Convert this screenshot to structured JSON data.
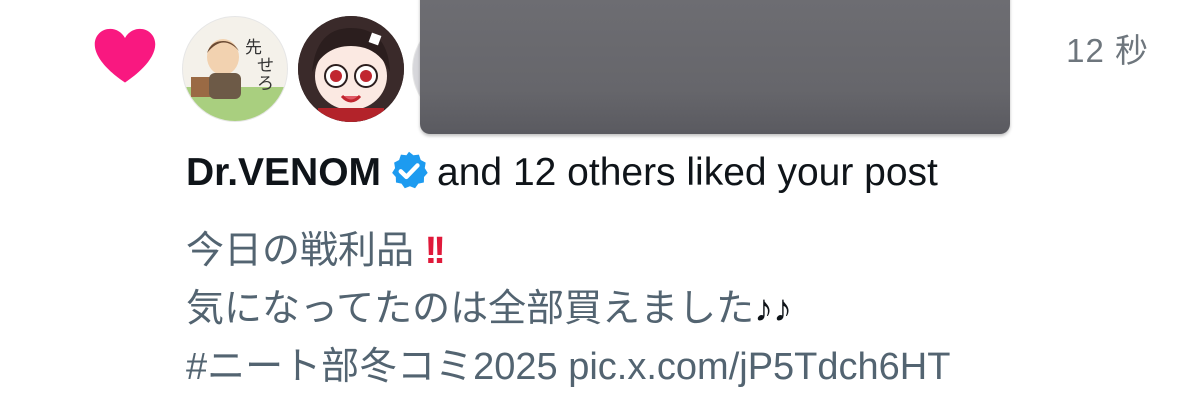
{
  "notification": {
    "type_icon": "heart-icon",
    "type_color": "#f91880",
    "timestamp": "12 秒",
    "avatars": [
      {
        "name": "avatar-user-1",
        "description": "cartoon man sitting on bench"
      },
      {
        "name": "avatar-user-2",
        "description": "anime girl with red eyes"
      },
      {
        "name": "avatar-user-3",
        "description": "partially hidden avatar"
      }
    ],
    "user_name": "Dr.VENOM",
    "verified_icon": "verified-badge-icon",
    "verified_color": "#1d9bf0",
    "action_text": "and 12 others liked your post"
  },
  "post": {
    "line1": "今日の戦利品",
    "line1_emoji": "!!",
    "line2": "気になってたのは全部買えました",
    "line2_emoji": "♪♪",
    "line3": " #ニート部冬コミ2025 pic.x.com/jP5Tdch6HT"
  }
}
